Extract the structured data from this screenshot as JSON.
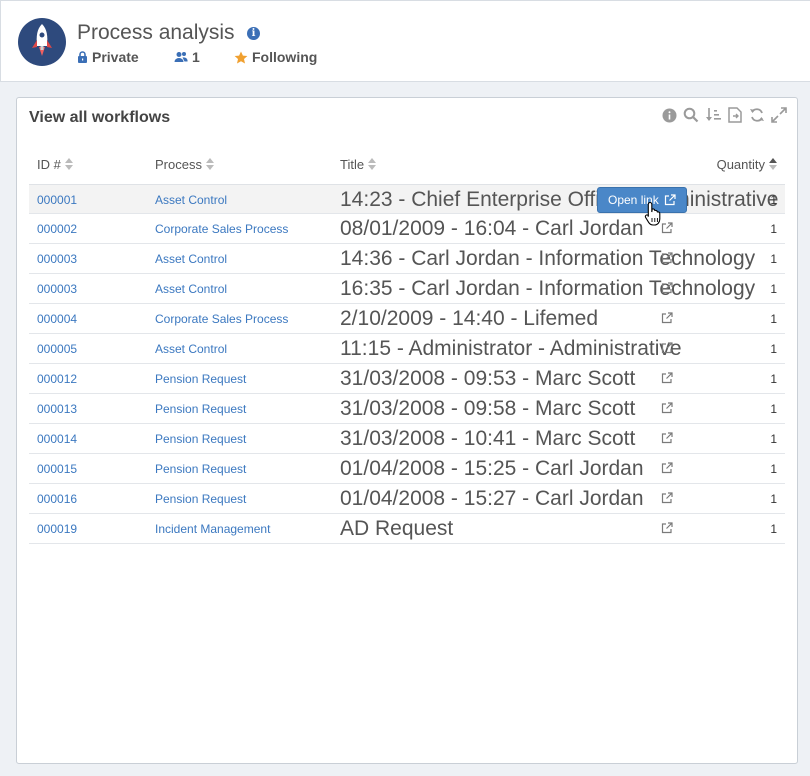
{
  "header": {
    "title": "Process analysis",
    "info": "i",
    "privacy": "Private",
    "members": "1",
    "following": "Following"
  },
  "card": {
    "title": "View all workflows",
    "toolbar": [
      "info-icon",
      "search-icon",
      "sort-icon",
      "export-icon",
      "refresh-icon",
      "expand-icon"
    ]
  },
  "table": {
    "columns": {
      "id": "ID #",
      "process": "Process",
      "title": "Title",
      "quantity": "Quantity"
    },
    "open_link_label": "Open link",
    "rows": [
      {
        "id": "000001",
        "process": "Asset Control",
        "title": "14:23 - Chief Enterprise Officer - Administrative",
        "quantity": "1"
      },
      {
        "id": "000002",
        "process": "Corporate Sales Process",
        "title": "08/01/2009 - 16:04 - Carl Jordan",
        "quantity": "1"
      },
      {
        "id": "000003",
        "process": "Asset Control",
        "title": "14:36 - Carl Jordan - Information Technology",
        "quantity": "1"
      },
      {
        "id": "000003",
        "process": "Asset Control",
        "title": "16:35 - Carl Jordan - Information Technology",
        "quantity": "1"
      },
      {
        "id": "000004",
        "process": "Corporate Sales Process",
        "title": "2/10/2009 - 14:40 - Lifemed",
        "quantity": "1"
      },
      {
        "id": "000005",
        "process": "Asset Control",
        "title": "11:15 - Administrator - Administrative",
        "quantity": "1"
      },
      {
        "id": "000012",
        "process": "Pension Request",
        "title": "31/03/2008 - 09:53 - Marc Scott",
        "quantity": "1"
      },
      {
        "id": "000013",
        "process": "Pension Request",
        "title": "31/03/2008 - 09:58 - Marc Scott",
        "quantity": "1"
      },
      {
        "id": "000014",
        "process": "Pension Request",
        "title": "31/03/2008 - 10:41 - Marc Scott",
        "quantity": "1"
      },
      {
        "id": "000015",
        "process": "Pension Request",
        "title": "01/04/2008 - 15:25 - Carl Jordan",
        "quantity": "1"
      },
      {
        "id": "000016",
        "process": "Pension Request",
        "title": "01/04/2008 - 15:27 - Carl Jordan",
        "quantity": "1"
      },
      {
        "id": "000019",
        "process": "Incident Management",
        "title": "AD Request",
        "quantity": "1"
      }
    ]
  },
  "colors": {
    "link": "#3b78c0",
    "button": "#4a87c8",
    "star": "#f0a030",
    "avatar": "#2e4a7d"
  }
}
